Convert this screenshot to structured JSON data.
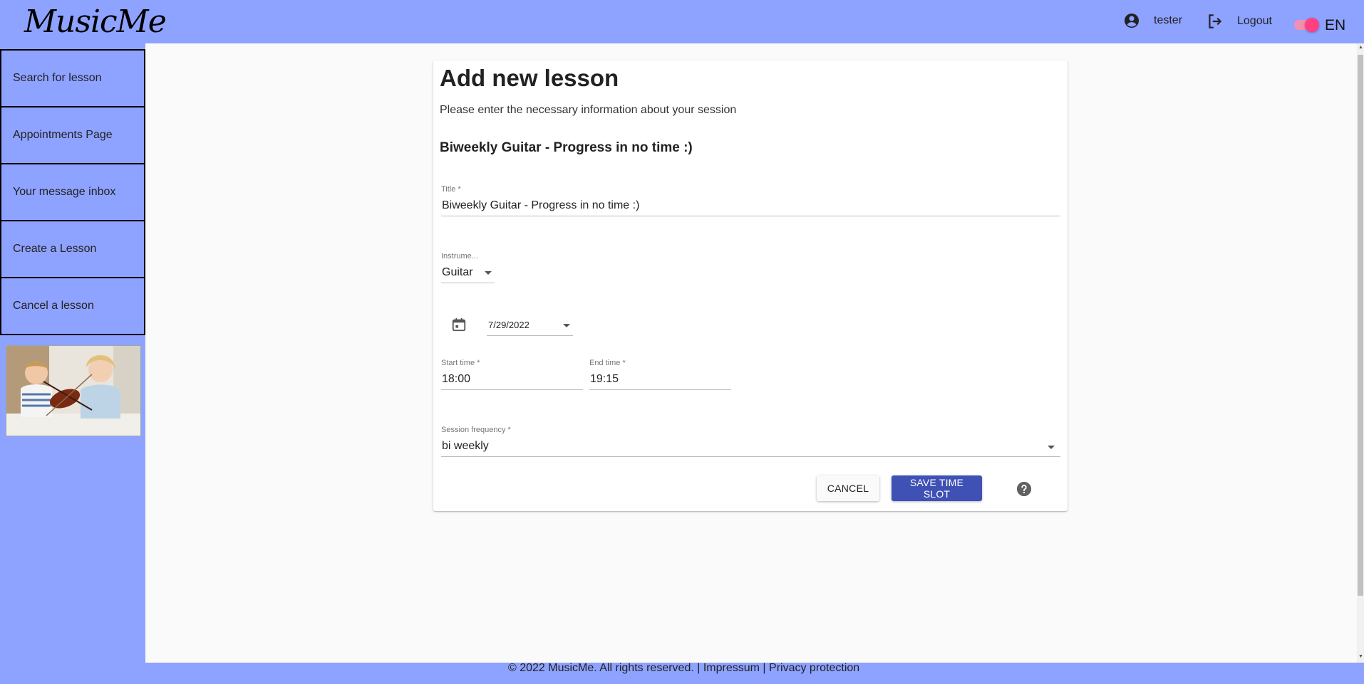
{
  "header": {
    "logo_text": "MusicMe",
    "username": "tester",
    "logout_label": "Logout",
    "language": "EN"
  },
  "sidebar": {
    "items": [
      {
        "label": "Search for lesson"
      },
      {
        "label": "Appointments Page"
      },
      {
        "label": "Your message inbox"
      },
      {
        "label": "Create a Lesson"
      },
      {
        "label": "Cancel a lesson"
      }
    ]
  },
  "form": {
    "heading": "Add new lesson",
    "subtitle": "Please enter the necessary information about your session",
    "lesson_title_display": "Biweekly Guitar - Progress in no time :)",
    "title_label": "Title *",
    "title_value": "Biweekly Guitar - Progress in no time :)",
    "instrument_label": "Instrume...",
    "instrument_value": "Guitar",
    "date_value": "7/29/2022",
    "start_label": "Start time *",
    "start_value": "18:00",
    "end_label": "End time *",
    "end_value": "19:15",
    "frequency_label": "Session frequency *",
    "frequency_value": "bi weekly",
    "cancel_label": "CANCEL",
    "save_label": "SAVE TIME SLOT"
  },
  "footer": {
    "copyright": "© 2022 MusicMe. All rights reserved.",
    "separator": "|",
    "impressum": "Impressum",
    "privacy": "Privacy protection"
  },
  "colors": {
    "brand": "#8ea2ff",
    "primary_button": "#3f51b5",
    "toggle": "#ff4081"
  },
  "icons": [
    "account-circle-icon",
    "logout-icon",
    "calendar-icon",
    "help-circle-icon",
    "chevron-down-icon"
  ]
}
